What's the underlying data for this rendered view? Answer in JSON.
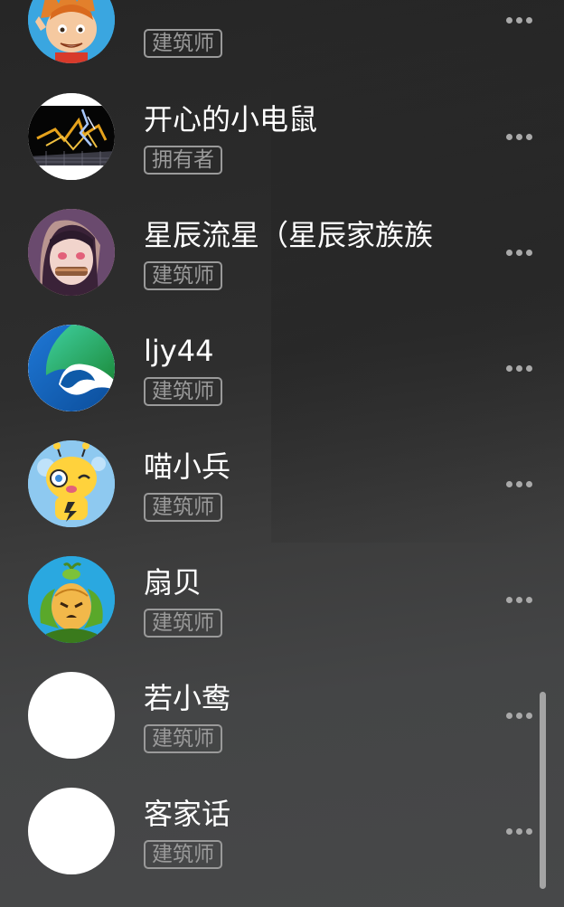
{
  "members": [
    {
      "name": "",
      "role": "建筑师",
      "avatar": "cartoon-boy-avatar"
    },
    {
      "name": "开心的小电鼠",
      "role": "拥有者",
      "avatar": "lightning-avatar"
    },
    {
      "name": "星辰流星（星辰家族族",
      "role": "建筑师",
      "avatar": "anime-girl-avatar"
    },
    {
      "name": "ljy44",
      "role": "建筑师",
      "avatar": "edge-logo-avatar"
    },
    {
      "name": "喵小兵",
      "role": "建筑师",
      "avatar": "yellow-robot-avatar"
    },
    {
      "name": "扇贝",
      "role": "建筑师",
      "avatar": "plant-creature-avatar"
    },
    {
      "name": "若小鸯",
      "role": "建筑师",
      "avatar": "blank-avatar"
    },
    {
      "name": "客家话",
      "role": "建筑师",
      "avatar": "blank-avatar"
    }
  ],
  "more_icon": "more-dots-icon",
  "colors": {
    "badge_border": "#9a9a9a",
    "name_text": "#ffffff",
    "scrollbar": "#a4a4a4"
  }
}
